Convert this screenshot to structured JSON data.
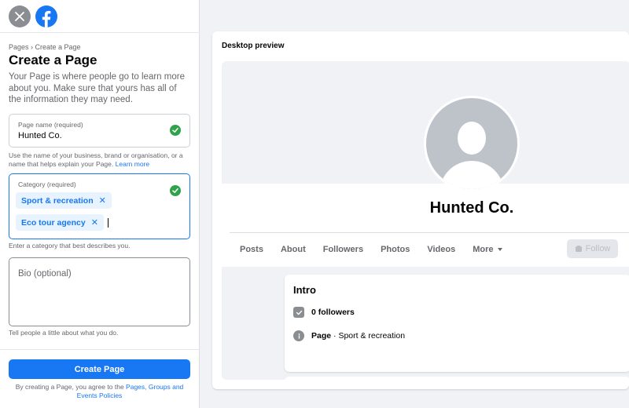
{
  "breadcrumb": "Pages › Create a Page",
  "title": "Create a Page",
  "intro": "Your Page is where people go to learn more about you. Make sure that yours has all of the information they may need.",
  "fields": {
    "name": {
      "label": "Page name (required)",
      "value": "Hunted Co.",
      "help": "Use the name of your business, brand or organisation, or a name that helps explain your Page.",
      "help_link": "Learn more"
    },
    "category": {
      "label": "Category (required)",
      "chips": [
        "Sport & recreation",
        "Eco tour agency"
      ],
      "chip_close": "✕",
      "help": "Enter a category that best describes you."
    },
    "bio": {
      "placeholder": "Bio (optional)",
      "help": "Tell people a little about what you do."
    }
  },
  "create_button": "Create Page",
  "terms": {
    "prefix": "By creating a Page, you agree to the",
    "link": "Pages, Groups and Events Policies"
  },
  "preview": {
    "label": "Desktop preview",
    "page_name": "Hunted Co.",
    "nav": [
      "Posts",
      "About",
      "Followers",
      "Photos",
      "Videos",
      "More"
    ],
    "follow": "Follow",
    "intro_title": "Intro",
    "followers": "0 followers",
    "page_label": "Page",
    "page_category": " · Sport & recreation"
  },
  "colors": {
    "brand": "#1877f2",
    "success": "#31a24c",
    "background": "#f0f2f5"
  }
}
